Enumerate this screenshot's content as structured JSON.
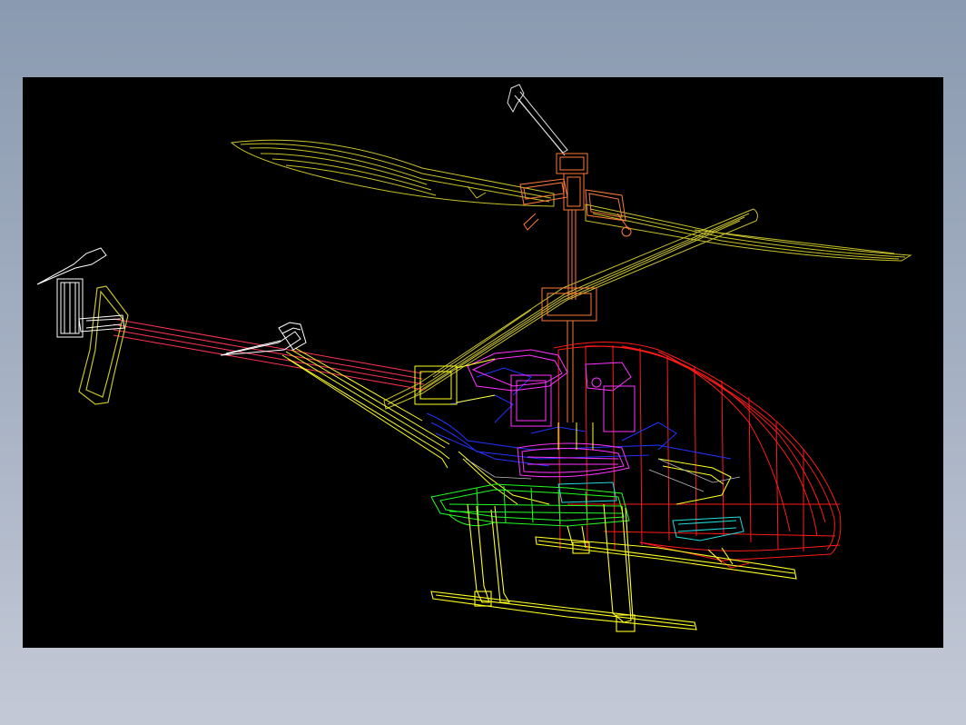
{
  "app": {
    "background_top": "#8a9ab0",
    "background_bottom": "#c4c9d6"
  },
  "viewport": {
    "background": "#000000",
    "subject": "rc-helicopter-wireframe-3d-cad-model"
  },
  "model_parts": [
    {
      "name": "main-rotor-blades",
      "color": "#c8c228"
    },
    {
      "name": "flybar-paddle",
      "color": "#c8c228"
    },
    {
      "name": "rotor-head",
      "color": "#ff7a3c"
    },
    {
      "name": "main-shaft",
      "color": "#ff7a3c"
    },
    {
      "name": "canopy",
      "color": "#ff1a1a"
    },
    {
      "name": "frame-servos",
      "color": "#ff33ff"
    },
    {
      "name": "chassis",
      "color": "#2233ff"
    },
    {
      "name": "electronics-board",
      "color": "#22ff22"
    },
    {
      "name": "battery",
      "color": "#22dddd"
    },
    {
      "name": "landing-skids",
      "color": "#ffff22"
    },
    {
      "name": "tail-boom",
      "color": "#ff3355"
    },
    {
      "name": "tail-fin",
      "color": "#c8c228"
    },
    {
      "name": "tail-rotor",
      "color": "#ffffff"
    },
    {
      "name": "horizontal-stabilizer",
      "color": "#ffffff"
    }
  ]
}
